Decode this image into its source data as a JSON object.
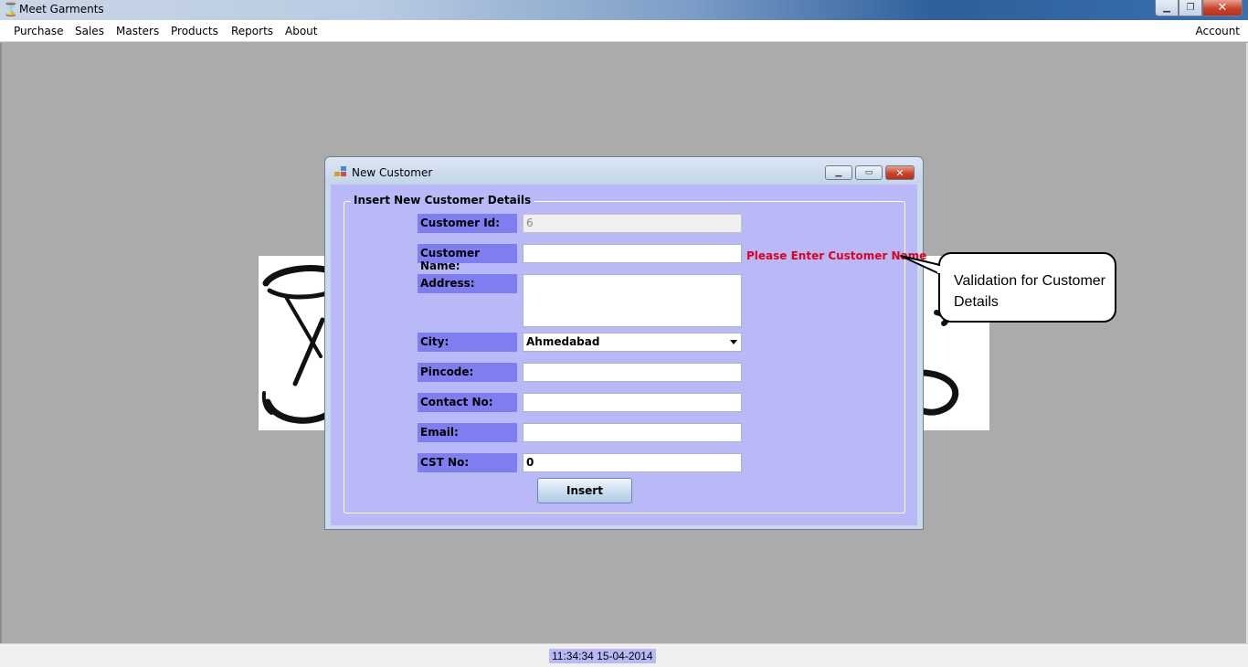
{
  "app": {
    "title": "Meet Garments"
  },
  "menu": {
    "items": [
      "Purchase",
      "Sales",
      "Masters",
      "Products",
      "Reports",
      "About"
    ],
    "account": "Account"
  },
  "dialog": {
    "title": "New Customer",
    "group_title": "Insert New Customer Details",
    "fields": {
      "customer_id": {
        "label": "Customer Id:",
        "value": "6"
      },
      "customer_name": {
        "label": "Customer Name:",
        "value": ""
      },
      "address": {
        "label": "Address:",
        "value": ""
      },
      "city": {
        "label": "City:",
        "value": "Ahmedabad"
      },
      "pincode": {
        "label": "Pincode:",
        "value": ""
      },
      "contact_no": {
        "label": "Contact No:",
        "value": ""
      },
      "email": {
        "label": "Email:",
        "value": ""
      },
      "cst_no": {
        "label": "CST No:",
        "value": "0"
      }
    },
    "validation_message": "Please Enter Customer Name",
    "insert_label": "Insert"
  },
  "callout": {
    "text": "Validation for Customer Details"
  },
  "status": {
    "clock": "11:34:34 15-04-2014"
  },
  "colors": {
    "label_bg": "#7e7ef0",
    "form_bg": "#b9b9f7",
    "validation": "#e1001e"
  }
}
